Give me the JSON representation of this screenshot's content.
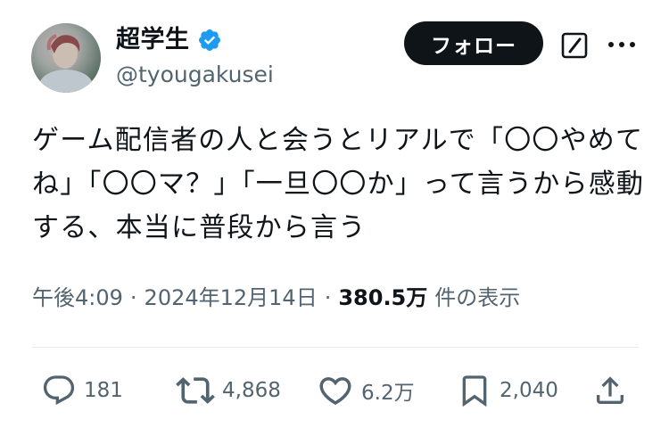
{
  "author": {
    "display_name": "超学生",
    "handle": "@tyougakusei",
    "verified": true
  },
  "header": {
    "follow_label": "フォロー"
  },
  "tweet": {
    "text": "ゲーム配信者の人と会うとリアルで「〇〇やめてね」「〇〇マ？」「一旦〇〇か」って言うから感動する、本当に普段から言う"
  },
  "meta": {
    "time": "午後4:09",
    "separator": "·",
    "date": "2024年12月14日",
    "views_count": "380.5万",
    "views_label": "件の表示"
  },
  "actions": {
    "replies": "181",
    "reposts": "4,868",
    "likes": "6.2万",
    "bookmarks": "2,040"
  },
  "icons": {
    "verified": "verified-badge-icon",
    "grok": "grok-icon",
    "more": "more-icon",
    "reply": "reply-icon",
    "repost": "repost-icon",
    "like": "like-icon",
    "bookmark": "bookmark-icon",
    "share": "share-icon"
  },
  "colors": {
    "text": "#0f1419",
    "secondary": "#536471",
    "verified": "#1d9bf0",
    "follow_bg": "#0f1419",
    "divider": "#e7e9ea"
  }
}
